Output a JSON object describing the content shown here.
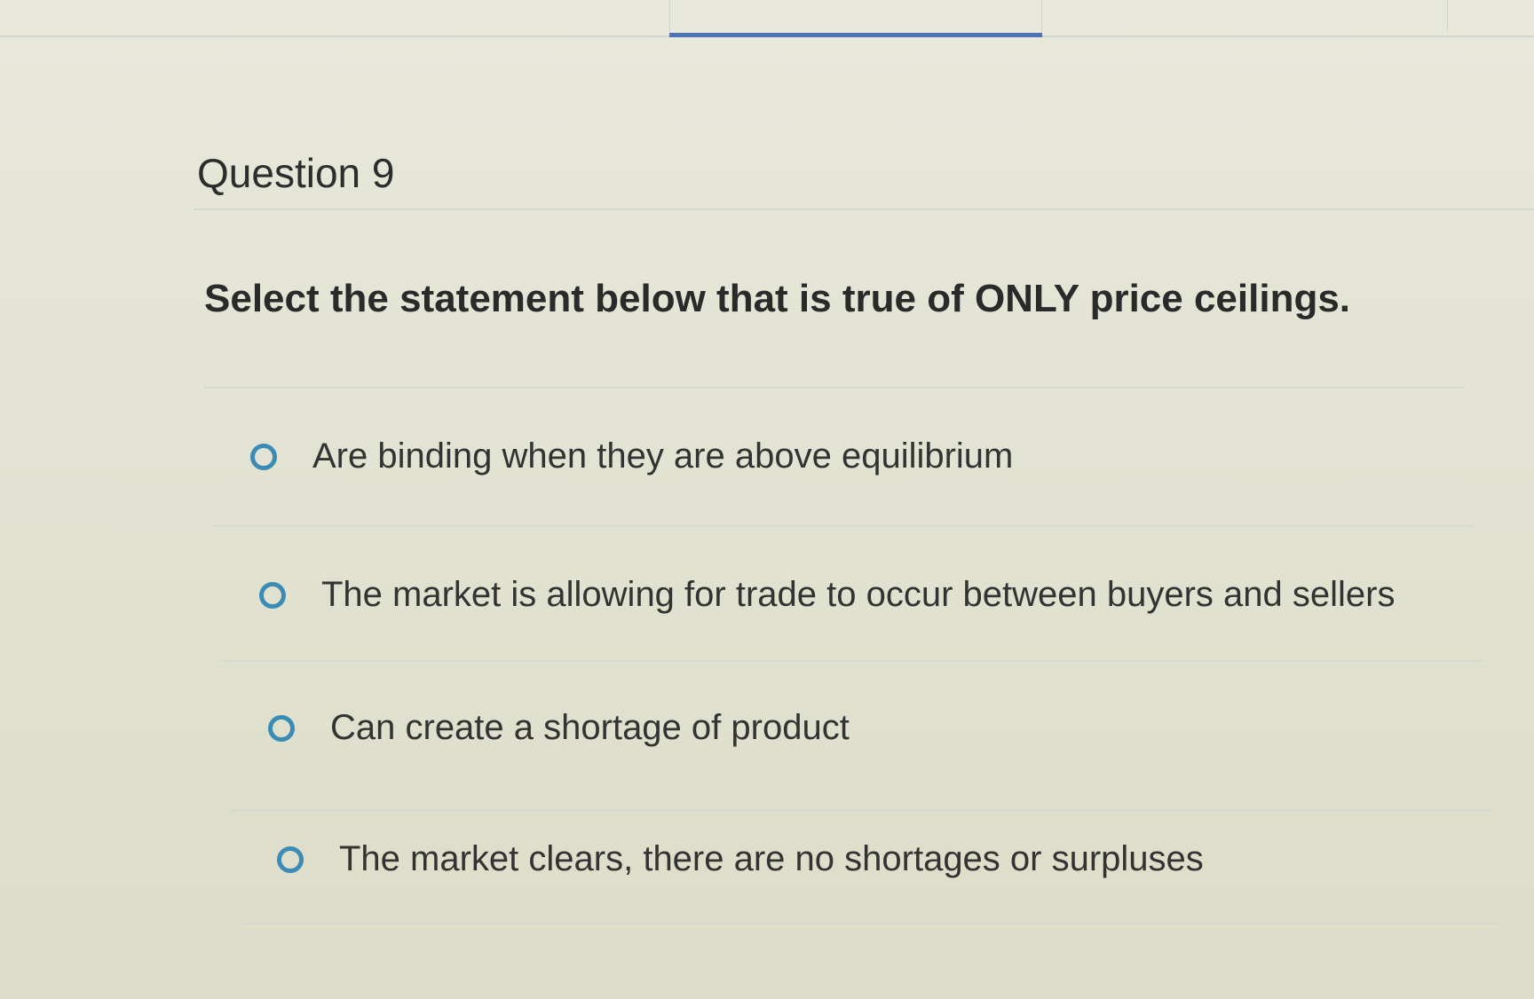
{
  "question": {
    "title": "Question 9",
    "prompt": "Select the statement below that is true of ONLY price ceilings."
  },
  "options": [
    {
      "label": "Are binding when they are above equilibrium",
      "selected": false
    },
    {
      "label": "The market is allowing for trade to occur between buyers and sellers",
      "selected": false
    },
    {
      "label": "Can create a shortage of product",
      "selected": false
    },
    {
      "label": "The market clears, there are no shortages or surpluses",
      "selected": false
    }
  ],
  "colors": {
    "radio": "#3a8cb6",
    "tab_underline": "#4d73b7",
    "background": "#e3e3d3"
  }
}
